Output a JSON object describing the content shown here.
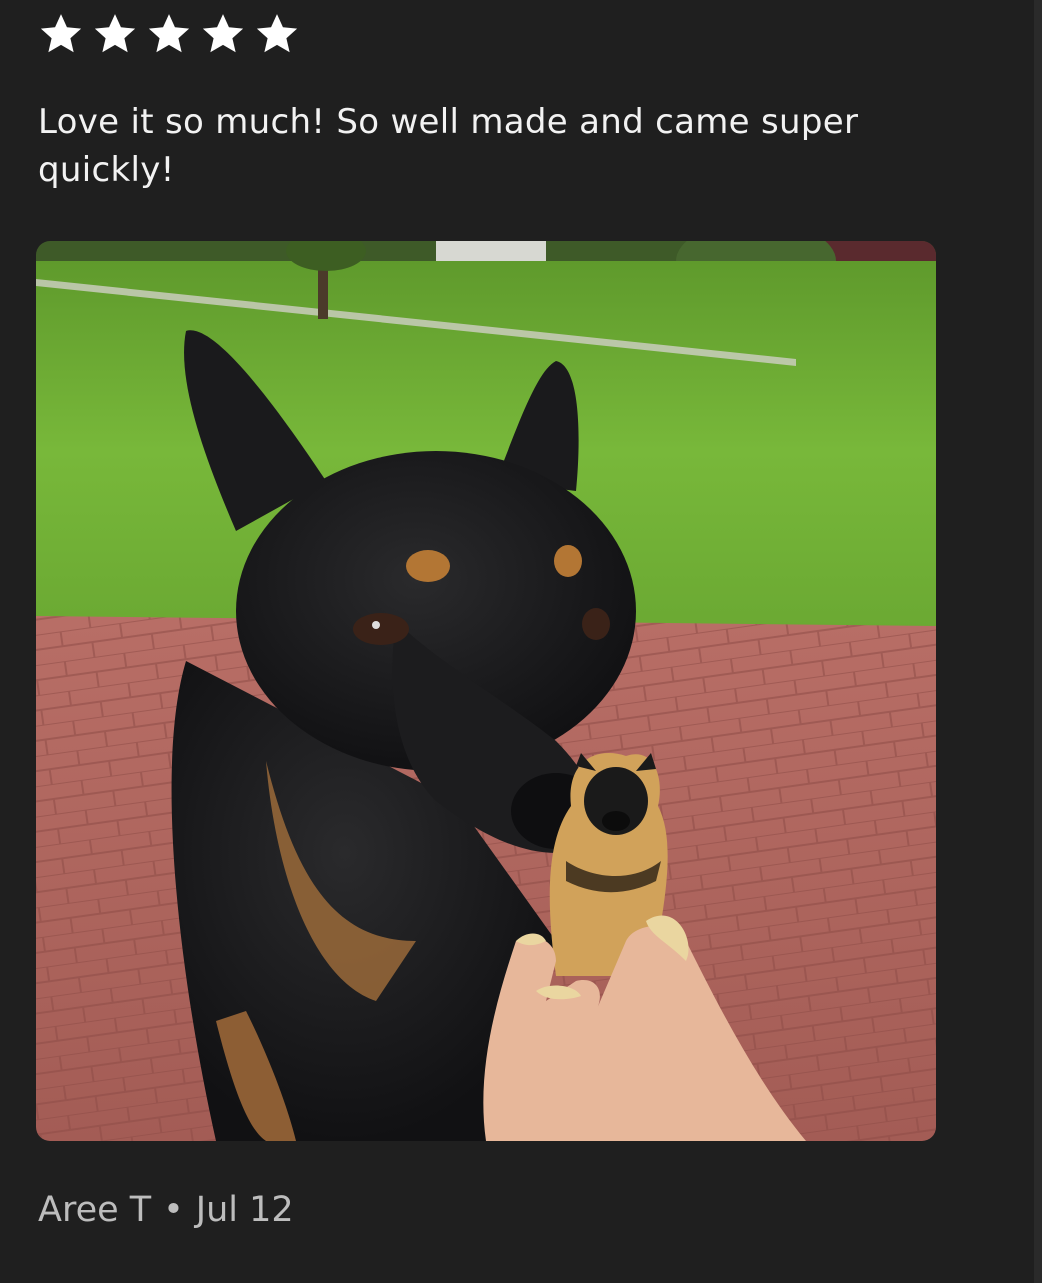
{
  "review": {
    "rating": 5,
    "rating_max": 5,
    "star_icon": "star-icon",
    "star_color": "#ffffff",
    "text": "Love it so much! So well made and came super quickly!",
    "photo_icon": "review-photo-dog-with-carved-figurine",
    "author": "Aree T",
    "separator": "•",
    "date": "Jul 12"
  },
  "colors": {
    "background": "#1f1f1f",
    "text": "#f2f2f2",
    "meta_text": "#bdbdbd"
  }
}
